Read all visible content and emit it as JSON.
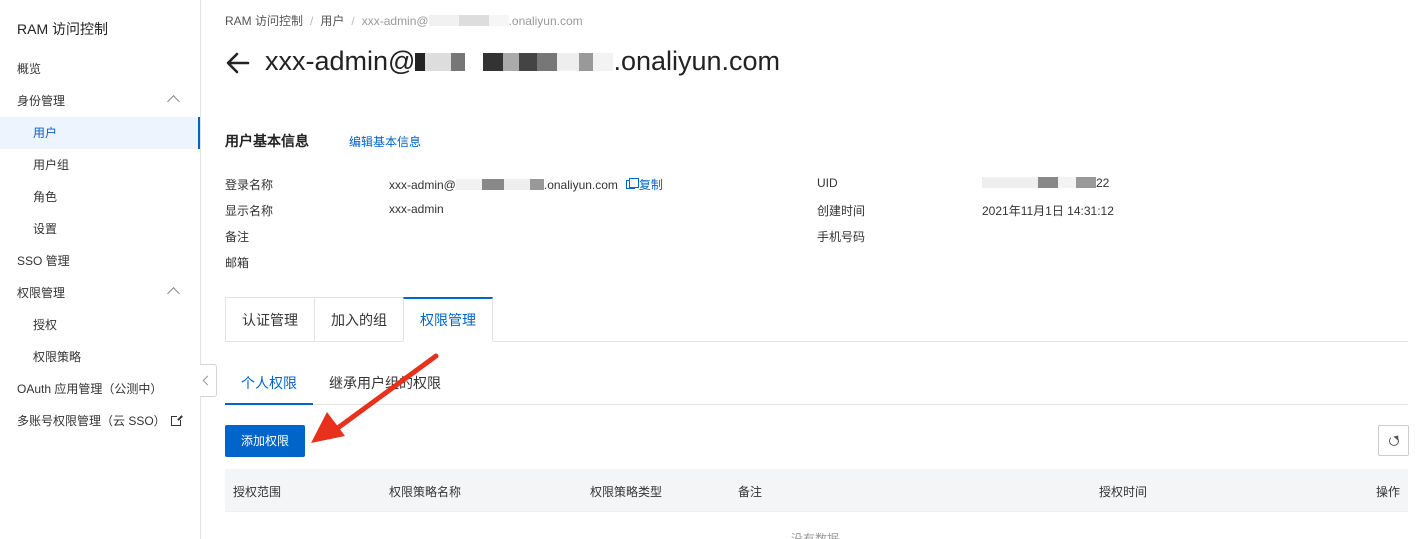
{
  "sidebar": {
    "title": "RAM 访问控制",
    "items": [
      {
        "label": "概览"
      },
      {
        "label": "身份管理"
      },
      {
        "label": "用户"
      },
      {
        "label": "用户组"
      },
      {
        "label": "角色"
      },
      {
        "label": "设置"
      },
      {
        "label": "SSO 管理"
      },
      {
        "label": "权限管理"
      },
      {
        "label": "授权"
      },
      {
        "label": "权限策略"
      },
      {
        "label": "OAuth 应用管理（公测中）"
      },
      {
        "label": "多账号权限管理（云 SSO）"
      }
    ]
  },
  "breadcrumb": {
    "items": [
      "RAM 访问控制",
      "用户"
    ],
    "current_prefix": "xxx-admin@",
    "current_suffix": ".onaliyun.com"
  },
  "header": {
    "title_prefix": "xxx-admin@",
    "title_suffix": ".onaliyun.com"
  },
  "basic_info": {
    "title": "用户基本信息",
    "edit_label": "编辑基本信息",
    "login_name_label": "登录名称",
    "login_name_prefix": "xxx-admin@",
    "login_name_suffix": ".onaliyun.com",
    "copy_label": "复制",
    "display_name_label": "显示名称",
    "display_name_value": "xxx-admin",
    "remark_label": "备注",
    "email_label": "邮箱",
    "uid_label": "UID",
    "uid_suffix": "22",
    "created_label": "创建时间",
    "created_value": "2021年11月1日 14:31:12",
    "phone_label": "手机号码"
  },
  "tabs": [
    {
      "label": "认证管理"
    },
    {
      "label": "加入的组"
    },
    {
      "label": "权限管理"
    }
  ],
  "subtabs": [
    {
      "label": "个人权限"
    },
    {
      "label": "继承用户组的权限"
    }
  ],
  "toolbar": {
    "add_label": "添加权限"
  },
  "table": {
    "columns": [
      "授权范围",
      "权限策略名称",
      "权限策略类型",
      "备注",
      "授权时间",
      "操作"
    ],
    "empty_text": "没有数据"
  },
  "colors": {
    "primary": "#0064c8",
    "annotation_arrow": "#e8311d"
  }
}
